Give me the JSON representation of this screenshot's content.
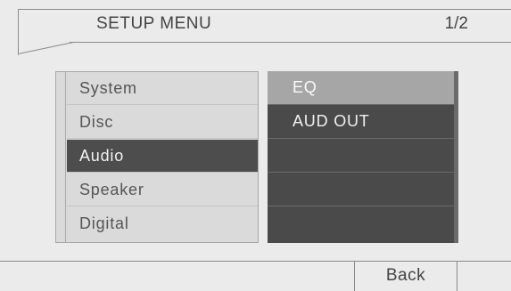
{
  "header": {
    "title": "SETUP MENU",
    "page_indicator": "1/2"
  },
  "menu": {
    "items": [
      {
        "label": "System"
      },
      {
        "label": "Disc"
      },
      {
        "label": "Audio"
      },
      {
        "label": "Speaker"
      },
      {
        "label": "Digital"
      }
    ],
    "selected": "Audio"
  },
  "options": {
    "items": [
      {
        "label": "EQ"
      },
      {
        "label": "AUD OUT"
      },
      {
        "label": ""
      },
      {
        "label": ""
      },
      {
        "label": ""
      }
    ],
    "highlighted": "EQ"
  },
  "footer": {
    "back_label": "Back"
  }
}
